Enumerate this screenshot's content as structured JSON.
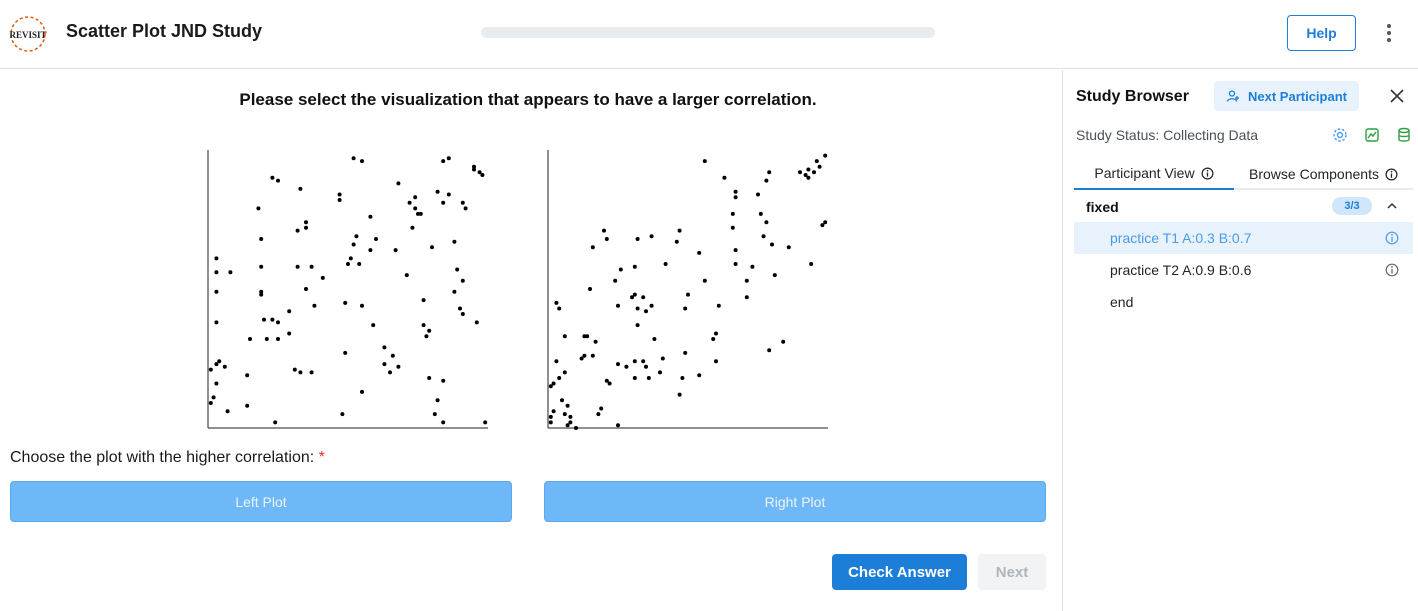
{
  "header": {
    "logo_text": "REVISIT",
    "title": "Scatter Plot JND Study",
    "progress": 0,
    "help_label": "Help"
  },
  "main": {
    "prompt": "Please select the visualization that appears to have a larger correlation.",
    "question": "Choose the plot with the higher correlation:",
    "required_mark": "*",
    "left_label": "Left Plot",
    "right_label": "Right Plot",
    "check_label": "Check Answer",
    "next_label": "Next"
  },
  "sidebar": {
    "title": "Study Browser",
    "next_participant_label": "Next Participant",
    "status": "Study Status: Collecting Data",
    "tabs": [
      {
        "label": "Participant View"
      },
      {
        "label": "Browse Components"
      }
    ],
    "group": {
      "name": "fixed",
      "count": "3/3"
    },
    "items": [
      {
        "label": "practice T1 A:0.3 B:0.7",
        "active": true
      },
      {
        "label": "practice T2 A:0.9 B:0.6",
        "active": false
      },
      {
        "label": "end",
        "active": false
      }
    ]
  },
  "colors": {
    "accent": "#1c7ed6",
    "choice_button": "#6fb8f7",
    "highlight": "#e7f2fd"
  },
  "chart_data": [
    {
      "type": "scatter",
      "title": "",
      "xlabel": "",
      "ylabel": "",
      "xlim": [
        0,
        1
      ],
      "ylim": [
        0,
        1
      ],
      "grid": false,
      "points": [
        [
          0.01,
          0.09
        ],
        [
          0.01,
          0.21
        ],
        [
          0.02,
          0.11
        ],
        [
          0.03,
          0.23
        ],
        [
          0.03,
          0.16
        ],
        [
          0.03,
          0.38
        ],
        [
          0.03,
          0.56
        ],
        [
          0.03,
          0.49
        ],
        [
          0.03,
          0.61
        ],
        [
          0.04,
          0.24
        ],
        [
          0.06,
          0.22
        ],
        [
          0.07,
          0.06
        ],
        [
          0.08,
          0.56
        ],
        [
          0.14,
          0.08
        ],
        [
          0.14,
          0.19
        ],
        [
          0.15,
          0.32
        ],
        [
          0.18,
          0.79
        ],
        [
          0.19,
          0.68
        ],
        [
          0.19,
          0.58
        ],
        [
          0.19,
          0.48
        ],
        [
          0.19,
          0.49
        ],
        [
          0.2,
          0.39
        ],
        [
          0.21,
          0.32
        ],
        [
          0.23,
          0.9
        ],
        [
          0.24,
          0.02
        ],
        [
          0.23,
          0.39
        ],
        [
          0.25,
          0.32
        ],
        [
          0.25,
          0.89
        ],
        [
          0.25,
          0.38
        ],
        [
          0.29,
          0.34
        ],
        [
          0.29,
          0.42
        ],
        [
          0.31,
          0.21
        ],
        [
          0.32,
          0.71
        ],
        [
          0.33,
          0.2
        ],
        [
          0.33,
          0.86
        ],
        [
          0.32,
          0.58
        ],
        [
          0.35,
          0.72
        ],
        [
          0.35,
          0.74
        ],
        [
          0.35,
          0.5
        ],
        [
          0.37,
          0.2
        ],
        [
          0.38,
          0.44
        ],
        [
          0.37,
          0.58
        ],
        [
          0.41,
          0.54
        ],
        [
          0.47,
          0.84
        ],
        [
          0.47,
          0.82
        ],
        [
          0.48,
          0.05
        ],
        [
          0.49,
          0.27
        ],
        [
          0.49,
          0.45
        ],
        [
          0.5,
          0.59
        ],
        [
          0.51,
          0.61
        ],
        [
          0.52,
          0.66
        ],
        [
          0.53,
          0.69
        ],
        [
          0.52,
          0.97
        ],
        [
          0.54,
          0.59
        ],
        [
          0.55,
          0.44
        ],
        [
          0.55,
          0.13
        ],
        [
          0.55,
          0.96
        ],
        [
          0.58,
          0.64
        ],
        [
          0.58,
          0.76
        ],
        [
          0.59,
          0.37
        ],
        [
          0.6,
          0.68
        ],
        [
          0.63,
          0.23
        ],
        [
          0.63,
          0.29
        ],
        [
          0.65,
          0.2
        ],
        [
          0.66,
          0.26
        ],
        [
          0.67,
          0.64
        ],
        [
          0.68,
          0.22
        ],
        [
          0.68,
          0.88
        ],
        [
          0.71,
          0.55
        ],
        [
          0.72,
          0.81
        ],
        [
          0.73,
          0.72
        ],
        [
          0.74,
          0.79
        ],
        [
          0.75,
          0.77
        ],
        [
          0.74,
          0.83
        ],
        [
          0.76,
          0.77
        ],
        [
          0.77,
          0.46
        ],
        [
          0.77,
          0.37
        ],
        [
          0.79,
          0.18
        ],
        [
          0.78,
          0.33
        ],
        [
          0.79,
          0.35
        ],
        [
          0.8,
          0.65
        ],
        [
          0.81,
          0.05
        ],
        [
          0.82,
          0.85
        ],
        [
          0.82,
          0.1
        ],
        [
          0.84,
          0.02
        ],
        [
          0.84,
          0.17
        ],
        [
          0.84,
          0.81
        ],
        [
          0.84,
          0.96
        ],
        [
          0.86,
          0.97
        ],
        [
          0.86,
          0.84
        ],
        [
          0.88,
          0.49
        ],
        [
          0.88,
          0.67
        ],
        [
          0.89,
          0.57
        ],
        [
          0.91,
          0.41
        ],
        [
          0.91,
          0.53
        ],
        [
          0.9,
          0.43
        ],
        [
          0.91,
          0.81
        ],
        [
          0.92,
          0.79
        ],
        [
          0.95,
          0.93
        ],
        [
          0.95,
          0.94
        ],
        [
          0.96,
          0.38
        ],
        [
          0.97,
          0.92
        ],
        [
          0.98,
          0.91
        ],
        [
          0.99,
          0.02
        ]
      ]
    },
    {
      "type": "scatter",
      "title": "",
      "xlabel": "",
      "ylabel": "",
      "xlim": [
        0,
        1
      ],
      "ylim": [
        0,
        1
      ],
      "grid": false,
      "points": [
        [
          0.01,
          0.15
        ],
        [
          0.02,
          0.16
        ],
        [
          0.01,
          0.04
        ],
        [
          0.01,
          0.02
        ],
        [
          0.02,
          0.06
        ],
        [
          0.03,
          0.45
        ],
        [
          0.03,
          0.24
        ],
        [
          0.04,
          0.43
        ],
        [
          0.04,
          0.18
        ],
        [
          0.05,
          0.1
        ],
        [
          0.06,
          0.05
        ],
        [
          0.06,
          0.2
        ],
        [
          0.06,
          0.33
        ],
        [
          0.07,
          0.08
        ],
        [
          0.07,
          0.01
        ],
        [
          0.08,
          0.04
        ],
        [
          0.08,
          0.02
        ],
        [
          0.1,
          0.0
        ],
        [
          0.12,
          0.25
        ],
        [
          0.13,
          0.33
        ],
        [
          0.13,
          0.26
        ],
        [
          0.14,
          0.33
        ],
        [
          0.15,
          0.5
        ],
        [
          0.16,
          0.65
        ],
        [
          0.16,
          0.26
        ],
        [
          0.17,
          0.31
        ],
        [
          0.18,
          0.05
        ],
        [
          0.19,
          0.07
        ],
        [
          0.2,
          0.71
        ],
        [
          0.21,
          0.68
        ],
        [
          0.21,
          0.17
        ],
        [
          0.22,
          0.16
        ],
        [
          0.24,
          0.53
        ],
        [
          0.25,
          0.44
        ],
        [
          0.25,
          0.23
        ],
        [
          0.26,
          0.57
        ],
        [
          0.25,
          0.01
        ],
        [
          0.28,
          0.22
        ],
        [
          0.3,
          0.47
        ],
        [
          0.31,
          0.24
        ],
        [
          0.31,
          0.48
        ],
        [
          0.31,
          0.58
        ],
        [
          0.32,
          0.68
        ],
        [
          0.32,
          0.43
        ],
        [
          0.31,
          0.18
        ],
        [
          0.32,
          0.37
        ],
        [
          0.34,
          0.24
        ],
        [
          0.34,
          0.47
        ],
        [
          0.35,
          0.22
        ],
        [
          0.35,
          0.42
        ],
        [
          0.36,
          0.18
        ],
        [
          0.37,
          0.44
        ],
        [
          0.37,
          0.69
        ],
        [
          0.38,
          0.32
        ],
        [
          0.4,
          0.2
        ],
        [
          0.41,
          0.25
        ],
        [
          0.42,
          0.59
        ],
        [
          0.47,
          0.12
        ],
        [
          0.46,
          0.67
        ],
        [
          0.47,
          0.71
        ],
        [
          0.49,
          0.43
        ],
        [
          0.49,
          0.27
        ],
        [
          0.48,
          0.18
        ],
        [
          0.5,
          0.48
        ],
        [
          0.54,
          0.19
        ],
        [
          0.54,
          0.63
        ],
        [
          0.56,
          0.53
        ],
        [
          0.56,
          0.96
        ],
        [
          0.59,
          0.32
        ],
        [
          0.6,
          0.24
        ],
        [
          0.6,
          0.34
        ],
        [
          0.61,
          0.44
        ],
        [
          0.63,
          0.9
        ],
        [
          0.66,
          0.77
        ],
        [
          0.66,
          0.72
        ],
        [
          0.67,
          0.59
        ],
        [
          0.67,
          0.85
        ],
        [
          0.67,
          0.64
        ],
        [
          0.67,
          0.83
        ],
        [
          0.71,
          0.53
        ],
        [
          0.71,
          0.47
        ],
        [
          0.73,
          0.58
        ],
        [
          0.75,
          0.84
        ],
        [
          0.76,
          0.77
        ],
        [
          0.77,
          0.69
        ],
        [
          0.78,
          0.74
        ],
        [
          0.78,
          0.89
        ],
        [
          0.79,
          0.92
        ],
        [
          0.79,
          0.28
        ],
        [
          0.8,
          0.66
        ],
        [
          0.81,
          0.55
        ],
        [
          0.84,
          0.31
        ],
        [
          0.86,
          0.65
        ],
        [
          0.9,
          0.92
        ],
        [
          0.92,
          0.91
        ],
        [
          0.93,
          0.9
        ],
        [
          0.93,
          0.93
        ],
        [
          0.94,
          0.59
        ],
        [
          0.95,
          0.92
        ],
        [
          0.96,
          0.96
        ],
        [
          0.97,
          0.94
        ],
        [
          0.98,
          0.73
        ],
        [
          0.99,
          0.74
        ],
        [
          0.99,
          0.98
        ]
      ]
    }
  ]
}
